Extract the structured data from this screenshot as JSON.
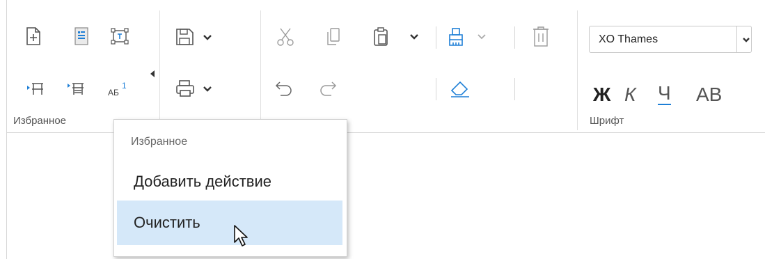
{
  "ribbon": {
    "groups": [
      {
        "label": "Избранное"
      },
      {
        "label": "Шрифт"
      }
    ],
    "favorites_icons": [
      "new-document-icon",
      "document-outline-icon",
      "text-box-icon",
      "insert-row-above-icon",
      "insert-row-below-icon",
      "superscript-icon",
      "overflow-arrow-icon"
    ],
    "file_icons": [
      "save-icon",
      "print-icon"
    ],
    "clipboard_icons": [
      "cut-icon",
      "copy-icon",
      "paste-icon",
      "undo-icon",
      "redo-icon"
    ],
    "format_icons": [
      "format-painter-icon",
      "eraser-icon",
      "delete-icon"
    ],
    "font": {
      "name": "XO Thames",
      "bold_label": "Ж",
      "italic_label": "К",
      "underline_label": "Ч",
      "caps_label": "АВ"
    }
  },
  "context_menu": {
    "header": "Избранное",
    "items": [
      {
        "label": "Добавить действие",
        "highlighted": false
      },
      {
        "label": "Очистить",
        "highlighted": true
      }
    ]
  },
  "colors": {
    "highlight": "#d5e8f9",
    "accent_blue": "#1e7fd6",
    "icon_gray": "#606060"
  }
}
